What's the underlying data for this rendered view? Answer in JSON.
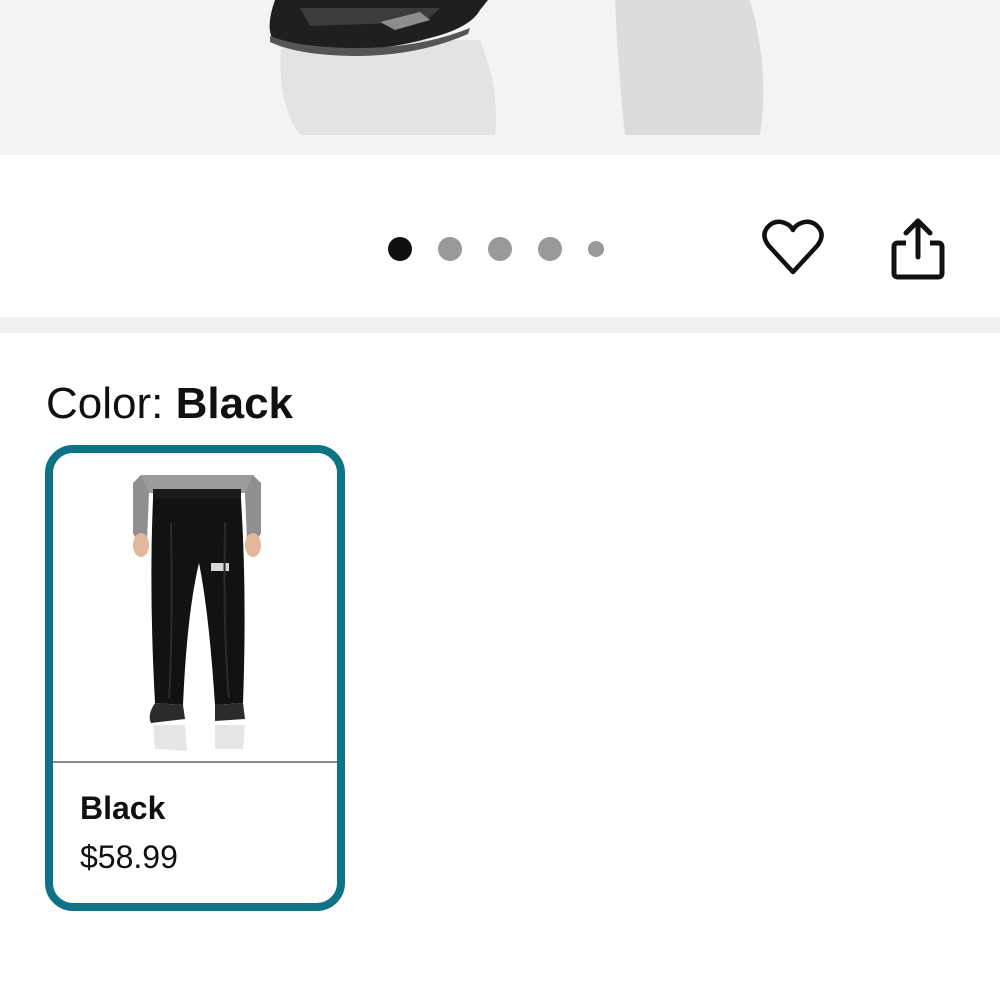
{
  "carousel": {
    "dots": [
      {
        "state": "active"
      },
      {
        "state": "inactive"
      },
      {
        "state": "inactive"
      },
      {
        "state": "inactive"
      },
      {
        "state": "small"
      }
    ],
    "favorite_icon": "heart-icon",
    "share_icon": "share-icon"
  },
  "color_selector": {
    "label": "Color: ",
    "selected_value": "Black",
    "options": [
      {
        "name": "Black",
        "price": "$58.99",
        "selected": true
      }
    ],
    "accent_color": "#0e7384"
  }
}
